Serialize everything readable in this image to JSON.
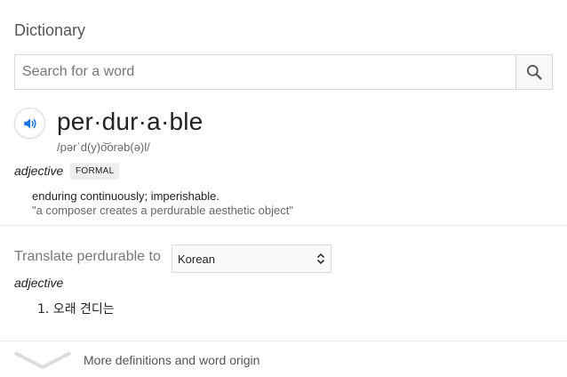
{
  "header": {
    "title": "Dictionary"
  },
  "search": {
    "placeholder": "Search for a word",
    "value": ""
  },
  "entry": {
    "word": "per·dur·a·ble",
    "phonetic": "/pərˈd(y)o͝orəb(ə)l/"
  },
  "sense": {
    "part_of_speech": "adjective",
    "register": "FORMAL",
    "definition": "enduring continuously; imperishable.",
    "example": "\"a composer creates a perdurable aesthetic object\""
  },
  "translate": {
    "label": "Translate perdurable to",
    "selected_language": "Korean",
    "part_of_speech": "adjective",
    "items": [
      "1. 오래 견디는"
    ]
  },
  "footer": {
    "more_label": "More definitions and word origin"
  },
  "colors": {
    "icon_blue": "#1a73e8",
    "chevron_gray": "#dadce0"
  }
}
